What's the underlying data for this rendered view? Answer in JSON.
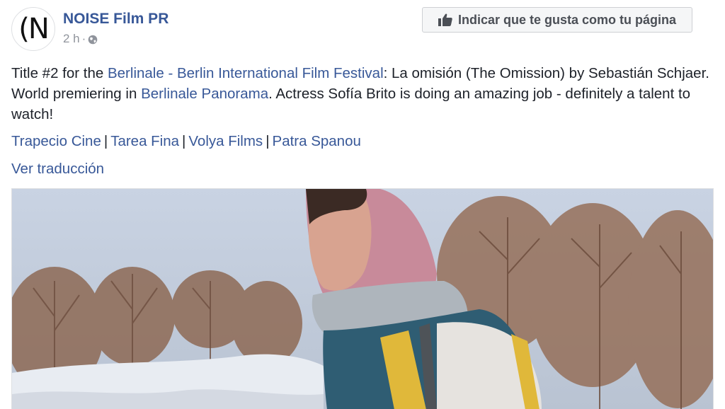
{
  "post": {
    "avatar_text": "(N",
    "page_name": "NOISE Film PR",
    "time": "2 h",
    "dot": "·",
    "privacy_icon": "globe-icon",
    "like_page_label": "Indicar que te gusta como tu página",
    "like_icon": "thumbs-up-icon",
    "text_parts": {
      "t1": "Title #2 for the ",
      "link1": "Berlinale - Berlin International Film Festival",
      "t2": ": La omisión (The Omission) by Sebastián Schjaer. World premiering in ",
      "link2": "Berlinale Panorama",
      "t3": ". Actress Sofía Brito is doing an amazing job - definitely a talent to watch!"
    },
    "credits": [
      "Trapecio Cine",
      "Tarea Fina",
      "Volya Films",
      "Patra Spanou"
    ],
    "credits_separator": "|",
    "translate_label": "Ver traducción"
  },
  "colors": {
    "link": "#385898",
    "text": "#1d2129",
    "muted": "#90949c",
    "button_bg": "#f5f6f7"
  }
}
